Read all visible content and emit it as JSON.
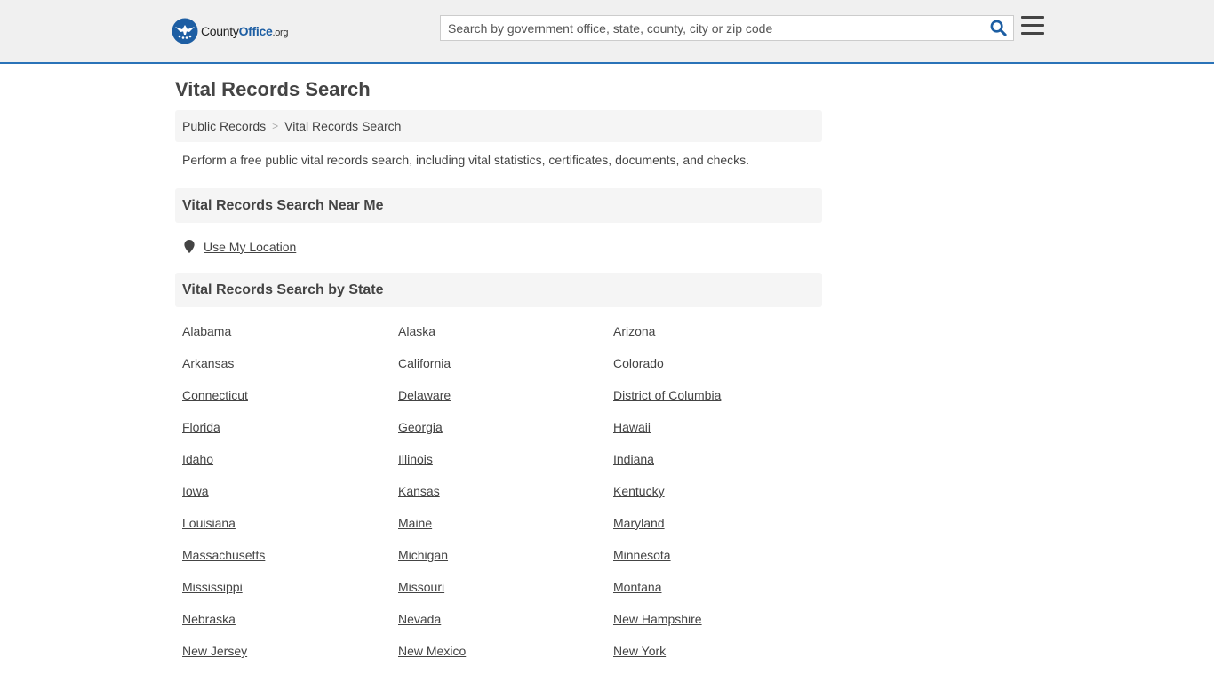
{
  "header": {
    "logo": {
      "county": "County",
      "office": "Office",
      "org": ".org"
    },
    "search": {
      "placeholder": "Search by government office, state, county, city or zip code",
      "value": ""
    },
    "icons": {
      "search": "search-icon",
      "menu": "hamburger-menu-icon",
      "logo": "eagle-seal-icon"
    },
    "accent_color": "#2a73b8"
  },
  "page": {
    "title": "Vital Records Search",
    "breadcrumb": {
      "items": [
        {
          "label": "Public Records"
        }
      ],
      "separator": ">",
      "current": "Vital Records Search"
    },
    "intro": "Perform a free public vital records search, including vital statistics, certificates, documents, and checks.",
    "near_me": {
      "heading": "Vital Records Search Near Me",
      "location_label": "Use My Location",
      "icon": "map-pin-icon"
    },
    "by_state": {
      "heading": "Vital Records Search by State",
      "states": [
        "Alabama",
        "Alaska",
        "Arizona",
        "Arkansas",
        "California",
        "Colorado",
        "Connecticut",
        "Delaware",
        "District of Columbia",
        "Florida",
        "Georgia",
        "Hawaii",
        "Idaho",
        "Illinois",
        "Indiana",
        "Iowa",
        "Kansas",
        "Kentucky",
        "Louisiana",
        "Maine",
        "Maryland",
        "Massachusetts",
        "Michigan",
        "Minnesota",
        "Mississippi",
        "Missouri",
        "Montana",
        "Nebraska",
        "Nevada",
        "New Hampshire",
        "New Jersey",
        "New Mexico",
        "New York"
      ]
    }
  }
}
